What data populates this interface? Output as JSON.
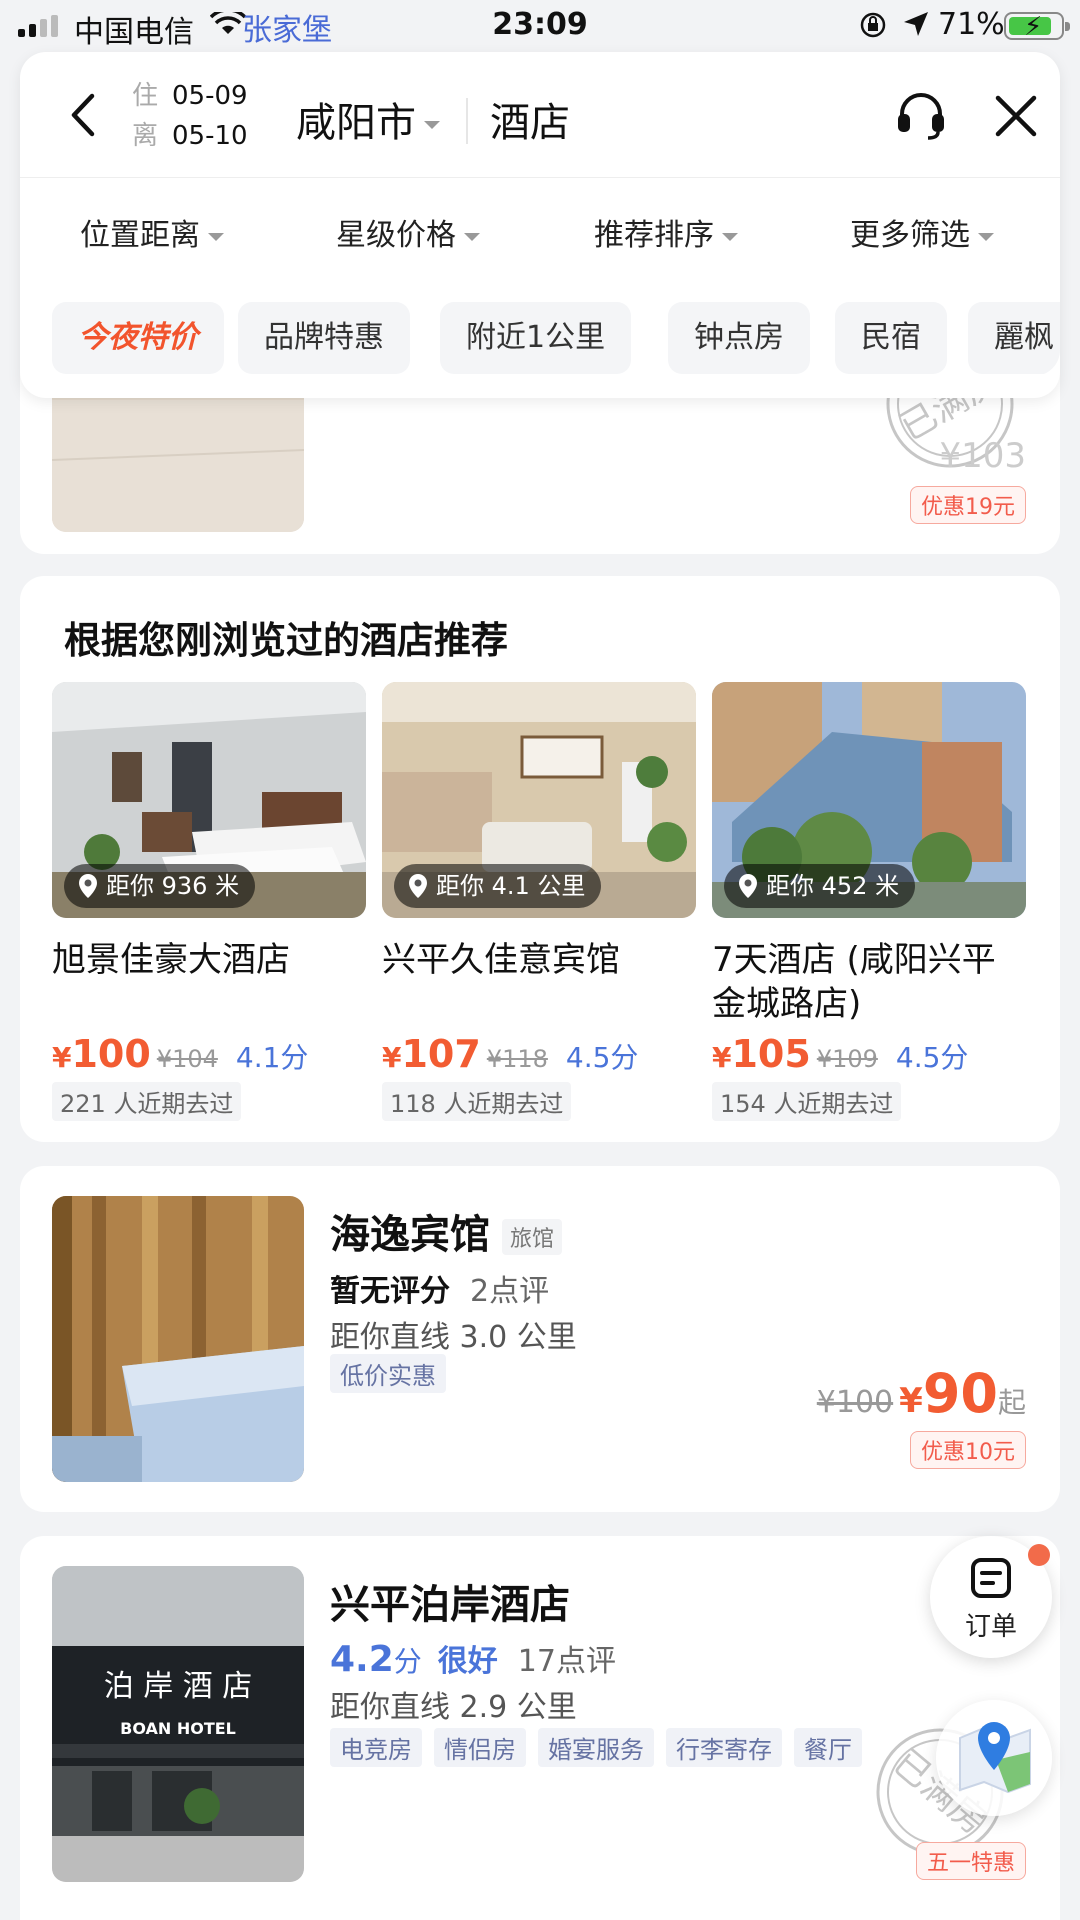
{
  "status_bar": {
    "carrier": "中国电信",
    "location": "张家堡",
    "time": "23:09",
    "battery": "71%",
    "battery_level": 0.71
  },
  "header": {
    "checkin_label": "住",
    "checkin_date": "05-09",
    "checkout_label": "离",
    "checkout_date": "05-10",
    "city": "咸阳市",
    "keyword": "酒店"
  },
  "filters": [
    "位置距离",
    "星级价格",
    "推荐排序",
    "更多筛选"
  ],
  "chips": [
    "今夜特价",
    "品牌特惠",
    "附近1公里",
    "钟点房",
    "民宿",
    "麗枫"
  ],
  "partial_card": {
    "price": "¥103",
    "discount": "优惠19元",
    "stamp": "已满房"
  },
  "recommendations": {
    "title": "根据您刚浏览过的酒店推荐",
    "items": [
      {
        "distance": "距你 936 米",
        "name": "旭景佳豪大酒店",
        "currency": "¥",
        "price": "100",
        "original": "¥104",
        "score": "4.1分",
        "visits": "221 人近期去过"
      },
      {
        "distance": "距你 4.1 公里",
        "name": "兴平久佳意宾馆",
        "currency": "¥",
        "price": "107",
        "original": "¥118",
        "score": "4.5分",
        "visits": "118 人近期去过"
      },
      {
        "distance": "距你 452 米",
        "name": "7天酒店 (咸阳兴平金城路店)",
        "currency": "¥",
        "price": "105",
        "original": "¥109",
        "score": "4.5分",
        "visits": "154 人近期去过"
      }
    ]
  },
  "hotels": [
    {
      "name": "海逸宾馆",
      "type": "旅馆",
      "no_rating": "暂无评分",
      "reviews": "2点评",
      "distance": "距你直线 3.0 公里",
      "tags": [
        "低价实惠"
      ],
      "original": "¥100",
      "currency": "¥",
      "price": "90",
      "suffix": "起",
      "discount": "优惠10元"
    },
    {
      "name": "兴平泊岸酒店",
      "score": "4.2",
      "score_unit": "分",
      "level": "很好",
      "reviews": "17点评",
      "distance": "距你直线 2.9 公里",
      "tags": [
        "电竞房",
        "情侣房",
        "婚宴服务",
        "行李寄存",
        "餐厅"
      ],
      "promo": "五一特惠",
      "stamp": "已满房",
      "sign_text": "泊 岸 酒 店",
      "sign_sub": "BOAN    HOTEL"
    }
  ],
  "floating": {
    "orders_label": "订单"
  },
  "colors": {
    "accent_blue": "#4a74d9",
    "price_red": "#f25c32",
    "hot_chip": "#f2542d"
  }
}
